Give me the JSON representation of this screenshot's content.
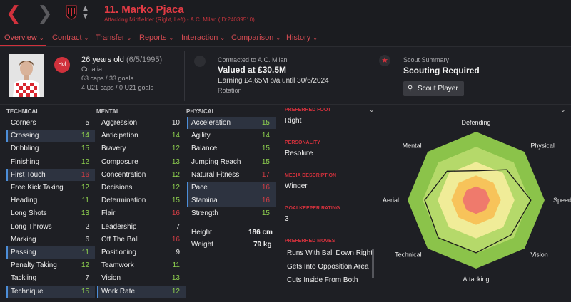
{
  "header": {
    "player_title": "11. Marko Pjaca",
    "player_subtitle": "Attacking Midfielder (Right, Left) - A.C. Milan (ID:24039510)"
  },
  "tabs": [
    {
      "label": "Overview"
    },
    {
      "label": "Contract"
    },
    {
      "label": "Transfer"
    },
    {
      "label": "Reports"
    },
    {
      "label": "Interaction"
    },
    {
      "label": "Comparison"
    },
    {
      "label": "History"
    }
  ],
  "profile": {
    "badge": "Hol",
    "age": "26 years old",
    "dob": "(6/5/1995)",
    "nation": "Croatia",
    "caps": "63 caps / 33 goals",
    "u21": "4 U21 caps / 0 U21 goals"
  },
  "contract": {
    "contracted": "Contracted to A.C. Milan",
    "valued": "Valued at £30.5M",
    "earning": "Earning £4.65M p/a until 30/6/2024",
    "status": "Rotation"
  },
  "scout": {
    "summary": "Scout Summary",
    "required": "Scouting Required",
    "button": "Scout Player"
  },
  "technical": {
    "heading": "TECHNICAL",
    "items": [
      {
        "name": "Corners",
        "value": "5"
      },
      {
        "name": "Crossing",
        "value": "14"
      },
      {
        "name": "Dribbling",
        "value": "15"
      },
      {
        "name": "Finishing",
        "value": "12"
      },
      {
        "name": "First Touch",
        "value": "16"
      },
      {
        "name": "Free Kick Taking",
        "value": "12"
      },
      {
        "name": "Heading",
        "value": "11"
      },
      {
        "name": "Long Shots",
        "value": "13"
      },
      {
        "name": "Long Throws",
        "value": "2"
      },
      {
        "name": "Marking",
        "value": "6"
      },
      {
        "name": "Passing",
        "value": "11"
      },
      {
        "name": "Penalty Taking",
        "value": "12"
      },
      {
        "name": "Tackling",
        "value": "7"
      },
      {
        "name": "Technique",
        "value": "15"
      }
    ]
  },
  "mental": {
    "heading": "MENTAL",
    "items": [
      {
        "name": "Aggression",
        "value": "10"
      },
      {
        "name": "Anticipation",
        "value": "14"
      },
      {
        "name": "Bravery",
        "value": "12"
      },
      {
        "name": "Composure",
        "value": "13"
      },
      {
        "name": "Concentration",
        "value": "12"
      },
      {
        "name": "Decisions",
        "value": "12"
      },
      {
        "name": "Determination",
        "value": "15"
      },
      {
        "name": "Flair",
        "value": "16"
      },
      {
        "name": "Leadership",
        "value": "7"
      },
      {
        "name": "Off The Ball",
        "value": "16"
      },
      {
        "name": "Positioning",
        "value": "9"
      },
      {
        "name": "Teamwork",
        "value": "11"
      },
      {
        "name": "Vision",
        "value": "13"
      },
      {
        "name": "Work Rate",
        "value": "12"
      }
    ]
  },
  "physical": {
    "heading": "PHYSICAL",
    "items": [
      {
        "name": "Acceleration",
        "value": "15"
      },
      {
        "name": "Agility",
        "value": "14"
      },
      {
        "name": "Balance",
        "value": "15"
      },
      {
        "name": "Jumping Reach",
        "value": "15"
      },
      {
        "name": "Natural Fitness",
        "value": "17"
      },
      {
        "name": "Pace",
        "value": "16"
      },
      {
        "name": "Stamina",
        "value": "16"
      },
      {
        "name": "Strength",
        "value": "15"
      }
    ],
    "height_label": "Height",
    "height": "186 cm",
    "weight_label": "Weight",
    "weight": "79 kg"
  },
  "info": {
    "foot_label": "PREFERRED FOOT",
    "foot": "Right",
    "personality_label": "PERSONALITY",
    "personality": "Resolute",
    "media_label": "MEDIA DESCRIPTION",
    "media": "Winger",
    "gk_label": "GOALKEEPER RATING",
    "gk": "3",
    "moves_label": "PREFERRED MOVES",
    "moves": [
      "Runs With Ball Down Right",
      "Gets Into Opposition Area",
      "Cuts Inside From Both"
    ]
  },
  "radar": {
    "labels": [
      "Defending",
      "Physical",
      "Speed",
      "Vision",
      "Attacking",
      "Technical",
      "Aerial",
      "Mental"
    ],
    "values": [
      0.43,
      0.63,
      0.8,
      0.72,
      0.77,
      0.78,
      0.75,
      0.6
    ]
  },
  "colors": {
    "accent": "#d0313c",
    "value_high": "#d63d45",
    "value_good": "#8fd14f",
    "value_mid": "#e6e6e6"
  }
}
